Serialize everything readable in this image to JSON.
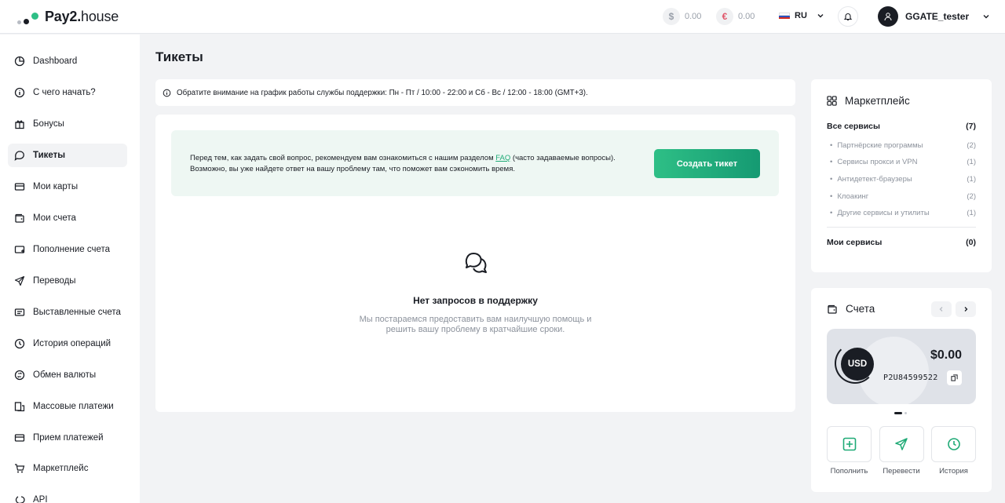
{
  "brand": {
    "name_bold": "Pay2.",
    "name_light": "house"
  },
  "header": {
    "balances": [
      {
        "symbol": "$",
        "amount": "0.00"
      },
      {
        "symbol": "€",
        "amount": "0.00"
      }
    ],
    "lang": "RU",
    "username": "GGATE_tester"
  },
  "sidebar": {
    "items": [
      {
        "label": "Dashboard",
        "icon": "dashboard-icon"
      },
      {
        "label": "С чего начать?",
        "icon": "info-icon"
      },
      {
        "label": "Бонусы",
        "icon": "gift-icon"
      },
      {
        "label": "Тикеты",
        "icon": "chat-icon",
        "active": true
      },
      {
        "label": "Мои карты",
        "icon": "card-icon"
      },
      {
        "label": "Мои счета",
        "icon": "wallet-icon"
      },
      {
        "label": "Пополнение счета",
        "icon": "topup-icon"
      },
      {
        "label": "Переводы",
        "icon": "send-icon"
      },
      {
        "label": "Выставленные счета",
        "icon": "invoice-icon"
      },
      {
        "label": "История операций",
        "icon": "clock-icon"
      },
      {
        "label": "Обмен валюты",
        "icon": "exchange-icon"
      },
      {
        "label": "Массовые платежи",
        "icon": "mass-pay-icon"
      },
      {
        "label": "Прием платежей",
        "icon": "accept-pay-icon"
      },
      {
        "label": "Маркетплейс",
        "icon": "cart-icon"
      },
      {
        "label": "API",
        "icon": "api-icon"
      }
    ]
  },
  "main": {
    "title": "Тикеты",
    "notice": "Обратите внимание на график работы службы поддержки: Пн - Пт / 10:00 - 22:00 и Сб - Вс / 12:00 - 18:00 (GMT+3).",
    "faq": {
      "line1_pre": "Перед тем, как задать свой вопрос, рекомендуем вам ознакомиться с нашим разделом ",
      "link": "FAQ",
      "line1_post": " (часто задаваемые вопросы).",
      "line2": "Возможно, вы уже найдете ответ на вашу проблему там, что поможет вам сэкономить время."
    },
    "create_button": "Создать тикет",
    "empty": {
      "title": "Нет запросов в поддержку",
      "line1": "Мы постараемся предоставить вам наилучшую помощь и",
      "line2": "решить вашу проблему в кратчайшие сроки."
    }
  },
  "marketplace": {
    "title": "Маркетплейс",
    "all_label": "Все сервисы",
    "all_count": "(7)",
    "items": [
      {
        "label": "Партнёрские программы",
        "count": "(2)"
      },
      {
        "label": "Сервисы прокси и VPN",
        "count": "(1)"
      },
      {
        "label": "Антидетект-браузеры",
        "count": "(1)"
      },
      {
        "label": "Клоакинг",
        "count": "(2)"
      },
      {
        "label": "Другие сервисы и утилиты",
        "count": "(1)"
      }
    ],
    "my_label": "Мои сервисы",
    "my_count": "(0)"
  },
  "accounts": {
    "title": "Счета",
    "currency": "USD",
    "amount": "$0.00",
    "number": "P2U84599522",
    "actions": [
      {
        "label": "Пополнить",
        "icon": "plus-square-icon"
      },
      {
        "label": "Перевести",
        "icon": "send-icon"
      },
      {
        "label": "История",
        "icon": "clock-icon"
      }
    ]
  },
  "colors": {
    "accent": "#1faa76",
    "accent_dark": "#159a72",
    "dark": "#1a1d24"
  }
}
